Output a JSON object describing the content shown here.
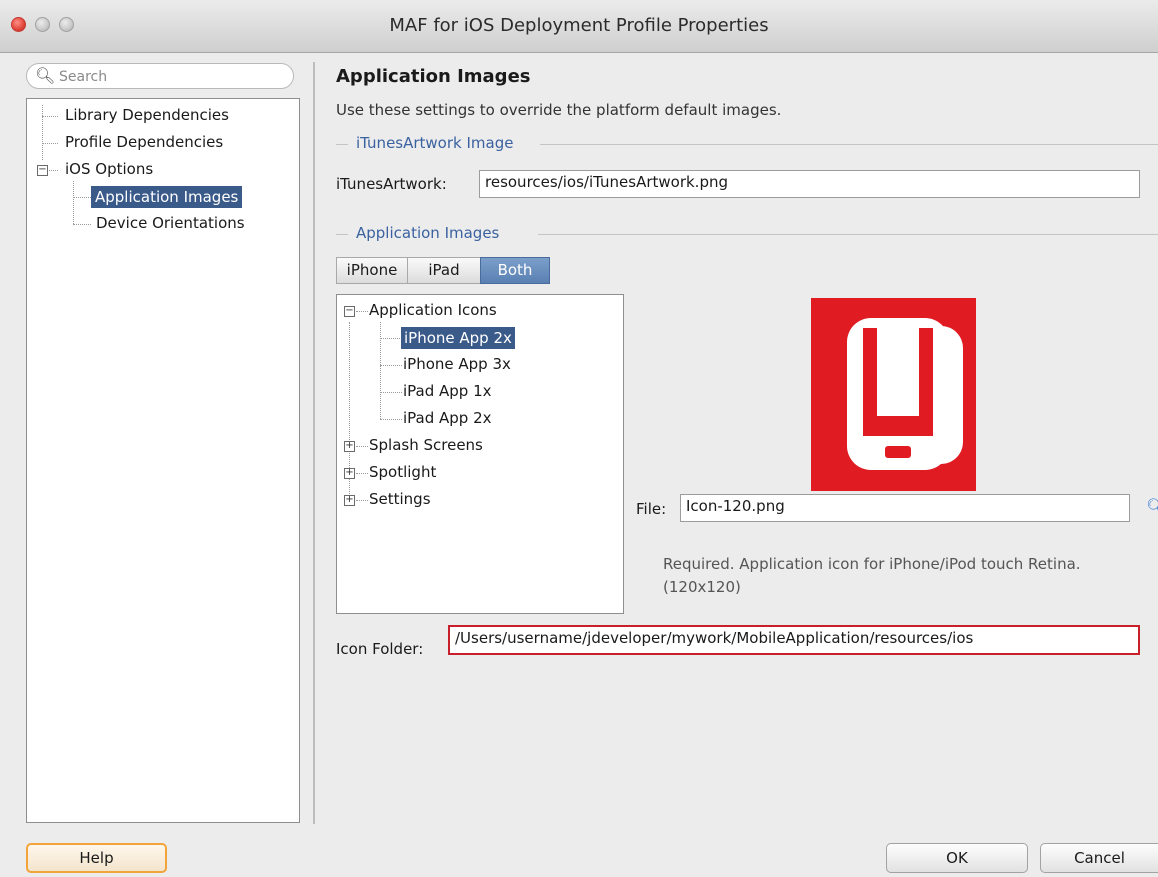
{
  "window": {
    "title": "MAF for iOS Deployment Profile Properties"
  },
  "search": {
    "placeholder": "Search"
  },
  "nav": {
    "items": [
      {
        "label": "Library Dependencies"
      },
      {
        "label": "Profile Dependencies"
      },
      {
        "label": "iOS Options"
      },
      {
        "label": "Application Images",
        "selected": true
      },
      {
        "label": "Device Orientations"
      }
    ]
  },
  "main": {
    "heading": "Application Images",
    "description": "Use these settings to override the platform default images.",
    "itunes_section": "iTunesArtwork Image",
    "itunes_label": "iTunesArtwork:",
    "itunes_value": "resources/ios/iTunesArtwork.png",
    "images_section": "Application Images",
    "device_tabs": [
      {
        "label": "iPhone"
      },
      {
        "label": "iPad"
      },
      {
        "label": "Both",
        "active": true
      }
    ],
    "tree": {
      "root": "Application Icons",
      "children": [
        "iPhone App 2x",
        "iPhone App 3x",
        "iPad App 1x",
        "iPad App 2x"
      ],
      "collapsed": [
        "Splash Screens",
        "Spotlight",
        "Settings"
      ]
    },
    "file_label": "File:",
    "file_value": "Icon-120.png",
    "file_help_line1": "Required. Application icon for iPhone/iPod touch Retina.",
    "file_help_line2": "(120x120)",
    "icon_folder_label": "Icon Folder:",
    "icon_folder_value": "/Users/username/jdeveloper/mywork/MobileApplication/resources/ios"
  },
  "buttons": {
    "help": "Help",
    "ok": "OK",
    "cancel": "Cancel"
  },
  "colors": {
    "accent": "#3a5a8a",
    "section": "#3a62a0",
    "icon_red": "#e11b22",
    "error": "#c8202a"
  }
}
